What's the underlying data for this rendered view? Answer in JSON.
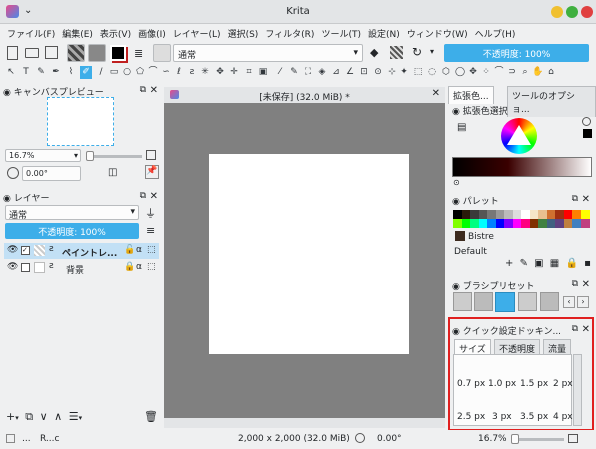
{
  "window": {
    "title": "Krita"
  },
  "menu": [
    "ファイル(F)",
    "編集(E)",
    "表示(V)",
    "画像(I)",
    "レイヤー(L)",
    "選択(S)",
    "フィルタ(R)",
    "ツール(T)",
    "設定(N)",
    "ウィンドウ(W)",
    "ヘルプ(H)"
  ],
  "toolbar": {
    "blend_mode": "通常",
    "opacity_label": "不透明度: 100%"
  },
  "overview": {
    "title": "キャンバスプレビュー",
    "zoom": "16.7%",
    "rotation": "0.00°"
  },
  "layers": {
    "title": "レイヤー",
    "blend": "通常",
    "opacity": "不透明度: 100%",
    "items": [
      {
        "name": "ペイントレ...",
        "active": true
      },
      {
        "name": "背景",
        "active": false
      }
    ]
  },
  "document": {
    "tab": "[未保存]  (32.0 MiB) *"
  },
  "dock_tabs": [
    "拡張色...",
    "ツールのオプショ..."
  ],
  "color_selector": {
    "title": "拡張色選択"
  },
  "palette": {
    "title": "パレット",
    "color_name": "Bistre",
    "set_name": "Default",
    "colors": [
      "#000000",
      "#2a1a0a",
      "#3a3a3a",
      "#555555",
      "#777777",
      "#999999",
      "#bbbbbb",
      "#dddddd",
      "#ffffff",
      "#f5e6c8",
      "#e8c090",
      "#d07030",
      "#a03010",
      "#ff0000",
      "#ff8000",
      "#ffff00",
      "#80ff00",
      "#00ff00",
      "#00ff80",
      "#00ffff",
      "#0080ff",
      "#0000ff",
      "#8000ff",
      "#ff00ff",
      "#ff0080",
      "#803000",
      "#408040",
      "#406080",
      "#604080",
      "#c08040",
      "#4080c0",
      "#c04080"
    ]
  },
  "brush_presets": {
    "title": "ブラシプリセット"
  },
  "quick_settings": {
    "title": "クイック設定ドッキン...",
    "tabs": [
      "サイズ",
      "不透明度",
      "流量"
    ],
    "sizes_row1": [
      "0.7 px",
      "1.0 px",
      "1.5 px",
      "2 px"
    ],
    "sizes_row2": [
      "2.5 px",
      "3 px",
      "3.5 px",
      "4 px"
    ]
  },
  "status": {
    "left": "...",
    "tool": "R...c",
    "dimensions": "2,000 x 2,000 (32.0 MiB)",
    "rotation": "0.00°",
    "zoom": "16.7%"
  },
  "colors": {
    "accent": "#3daee9",
    "highlight": "#e02020"
  }
}
